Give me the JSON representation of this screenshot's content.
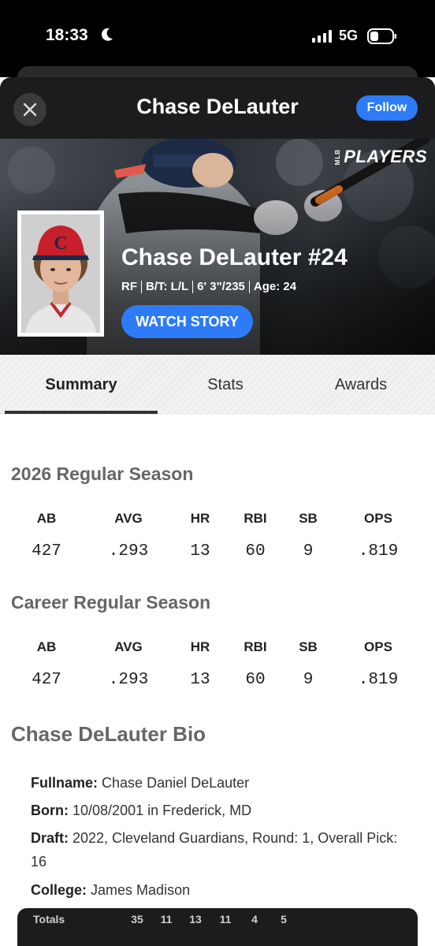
{
  "status_bar": {
    "time": "18:33",
    "network": "5G"
  },
  "header": {
    "title": "Chase DeLauter",
    "follow_label": "Follow"
  },
  "hero": {
    "logo_small": "MLB",
    "logo_text": "PLAYERS",
    "name": "Chase DeLauter #24",
    "position": "RF",
    "bats_throws": "B/T: L/L",
    "height_weight": "6' 3\"/235",
    "age": "Age: 24",
    "watch_story_label": "WATCH STORY",
    "cap_letter": "C"
  },
  "tabs": [
    {
      "label": "Summary",
      "active": true
    },
    {
      "label": "Stats",
      "active": false
    },
    {
      "label": "Awards",
      "active": false
    }
  ],
  "season": {
    "title": "2026 Regular Season",
    "headers": [
      "AB",
      "AVG",
      "HR",
      "RBI",
      "SB",
      "OPS"
    ],
    "values": [
      "427",
      ".293",
      "13",
      "60",
      "9",
      ".819"
    ]
  },
  "career": {
    "title": "Career Regular Season",
    "headers": [
      "AB",
      "AVG",
      "HR",
      "RBI",
      "SB",
      "OPS"
    ],
    "values": [
      "427",
      ".293",
      "13",
      "60",
      "9",
      ".819"
    ]
  },
  "bio": {
    "title": "Chase DeLauter Bio",
    "fullname_label": "Fullname:",
    "fullname": "Chase Daniel DeLauter",
    "born_label": "Born:",
    "born": "10/08/2001 in Frederick, MD",
    "draft_label": "Draft:",
    "draft": "2022, Cleveland Guardians, Round: 1, Overall Pick: 16",
    "college_label": "College:",
    "college": "James Madison"
  },
  "totals": {
    "label": "Totals",
    "values": [
      "35",
      "11",
      "13",
      "11",
      "4",
      "5"
    ]
  },
  "colors": {
    "accent_blue": "#2d7bf6",
    "dark_bg": "#1c1c1e",
    "section_gray": "#666666"
  }
}
